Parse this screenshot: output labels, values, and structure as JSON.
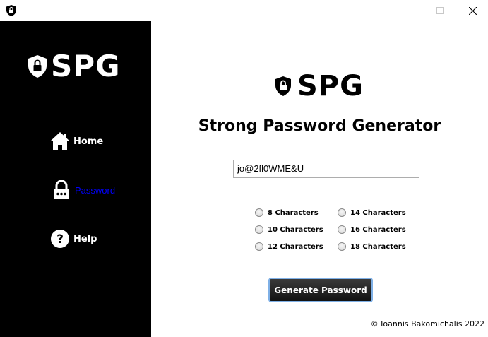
{
  "window": {
    "icon": "shield-lock-icon",
    "buttons": [
      "minimize-icon",
      "maximize-icon",
      "close-icon"
    ]
  },
  "brand": {
    "logo_text": "SPG",
    "logo_icon": "shield-lock-icon"
  },
  "sidebar": {
    "items": [
      {
        "label": "Home",
        "icon": "home-icon"
      },
      {
        "label": "Password",
        "icon": "lock-icon",
        "active": true
      },
      {
        "label": "Help",
        "icon": "help-icon"
      }
    ]
  },
  "main": {
    "title": "Strong Password Generator",
    "password_value": "jo@2fl0WME&U",
    "length_options": [
      {
        "label": "8 Characters",
        "selected": false
      },
      {
        "label": "10 Characters",
        "selected": false
      },
      {
        "label": "12 Characters",
        "selected": false
      },
      {
        "label": "14 Characters",
        "selected": false
      },
      {
        "label": "16 Characters",
        "selected": false
      },
      {
        "label": "18 Characters",
        "selected": false
      }
    ],
    "generate_label": "Generate Password",
    "footer": "© Ioannis Bakomichalis 2022"
  },
  "colors": {
    "sidebar_bg": "#000000",
    "active_nav": "#0000ff",
    "button_border": "#7fb0e6"
  }
}
